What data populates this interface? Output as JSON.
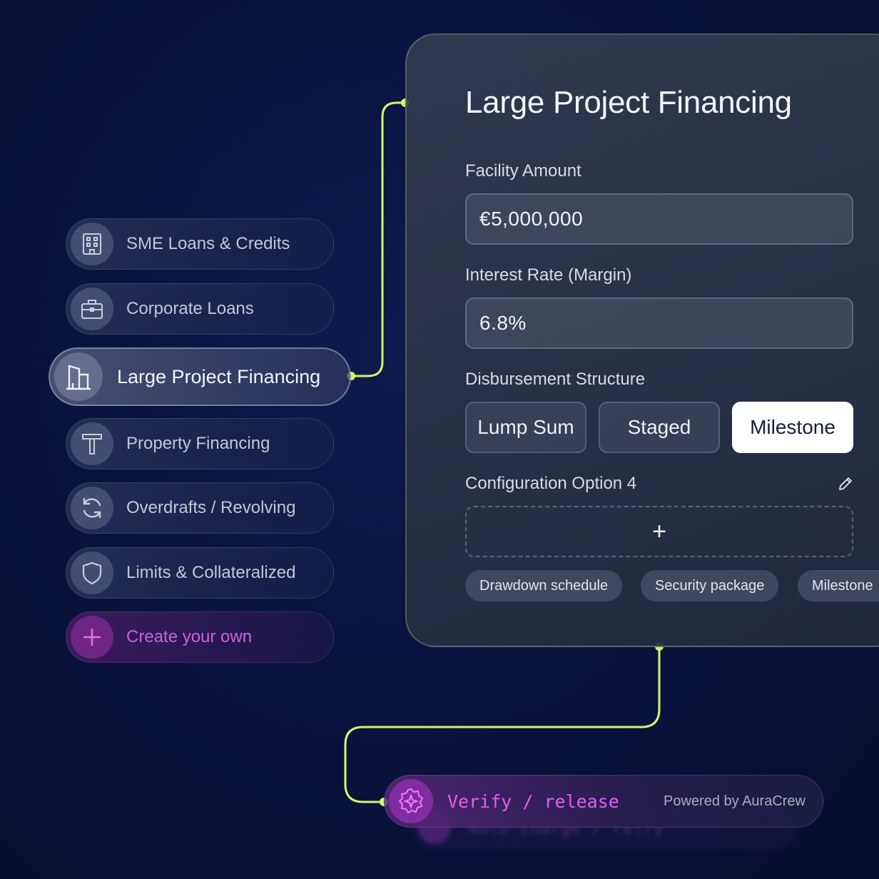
{
  "colors": {
    "accent_lime": "#d6f56a",
    "accent_magenta": "#d15ee0",
    "background": "#0b1440",
    "selected_segment": "#ffffff"
  },
  "sidebar": {
    "items": [
      {
        "label": "SME Loans & Credits",
        "icon": "building-icon"
      },
      {
        "label": "Corporate Loans",
        "icon": "briefcase-icon"
      },
      {
        "label": "Large Project Financing",
        "icon": "office-building-icon",
        "active": true
      },
      {
        "label": "Property Financing",
        "icon": "hammer-icon"
      },
      {
        "label": "Overdrafts /  Revolving",
        "icon": "refresh-icon"
      },
      {
        "label": "Limits & Collateralized",
        "icon": "shield-icon"
      },
      {
        "label": "Create your own",
        "icon": "plus-icon"
      }
    ]
  },
  "panel": {
    "title": "Large Project Financing",
    "facility_amount": {
      "label": "Facility Amount",
      "value": "€5,000,000"
    },
    "interest_rate": {
      "label": "Interest Rate (Margin)",
      "value": "6.8%"
    },
    "disbursement": {
      "label": "Disbursement Structure",
      "options": [
        "Lump Sum",
        "Staged",
        "Milestone"
      ],
      "selected": "Milestone"
    },
    "config": {
      "label": "Configuration Option 4",
      "add_symbol": "+",
      "chips": [
        "Drawdown schedule",
        "Security package",
        "Milestone"
      ]
    }
  },
  "verify_bar": {
    "text": "Verify / release",
    "powered_by": "Powered by AuraCrew",
    "ghost_text": "Auto-charge / retry"
  }
}
